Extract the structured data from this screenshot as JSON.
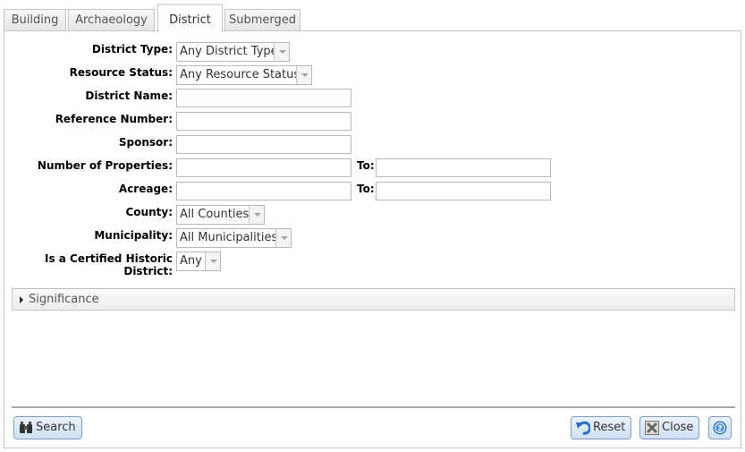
{
  "tabs": [
    {
      "label": "Building",
      "active": false
    },
    {
      "label": "Archaeology",
      "active": false
    },
    {
      "label": "District",
      "active": true
    },
    {
      "label": "Submerged",
      "active": false
    }
  ],
  "form": {
    "district_type": {
      "label": "District Type:",
      "value": "Any District Type"
    },
    "resource_status": {
      "label": "Resource Status:",
      "value": "Any Resource Status"
    },
    "district_name": {
      "label": "District Name:",
      "value": ""
    },
    "reference_number": {
      "label": "Reference Number:",
      "value": ""
    },
    "sponsor": {
      "label": "Sponsor:",
      "value": ""
    },
    "number_of_properties": {
      "label": "Number of Properties:",
      "from": "",
      "to_label": "To:",
      "to": ""
    },
    "acreage": {
      "label": "Acreage:",
      "from": "",
      "to_label": "To:",
      "to": ""
    },
    "county": {
      "label": "County:",
      "value": "All Counties"
    },
    "municipality": {
      "label": "Municipality:",
      "value": "All Municipalities"
    },
    "certified": {
      "label": "Is a Certified Historic District:",
      "value": "Any"
    }
  },
  "significance": {
    "label": "Significance"
  },
  "buttons": {
    "search": "Search",
    "reset": "Reset",
    "close": "Close"
  }
}
